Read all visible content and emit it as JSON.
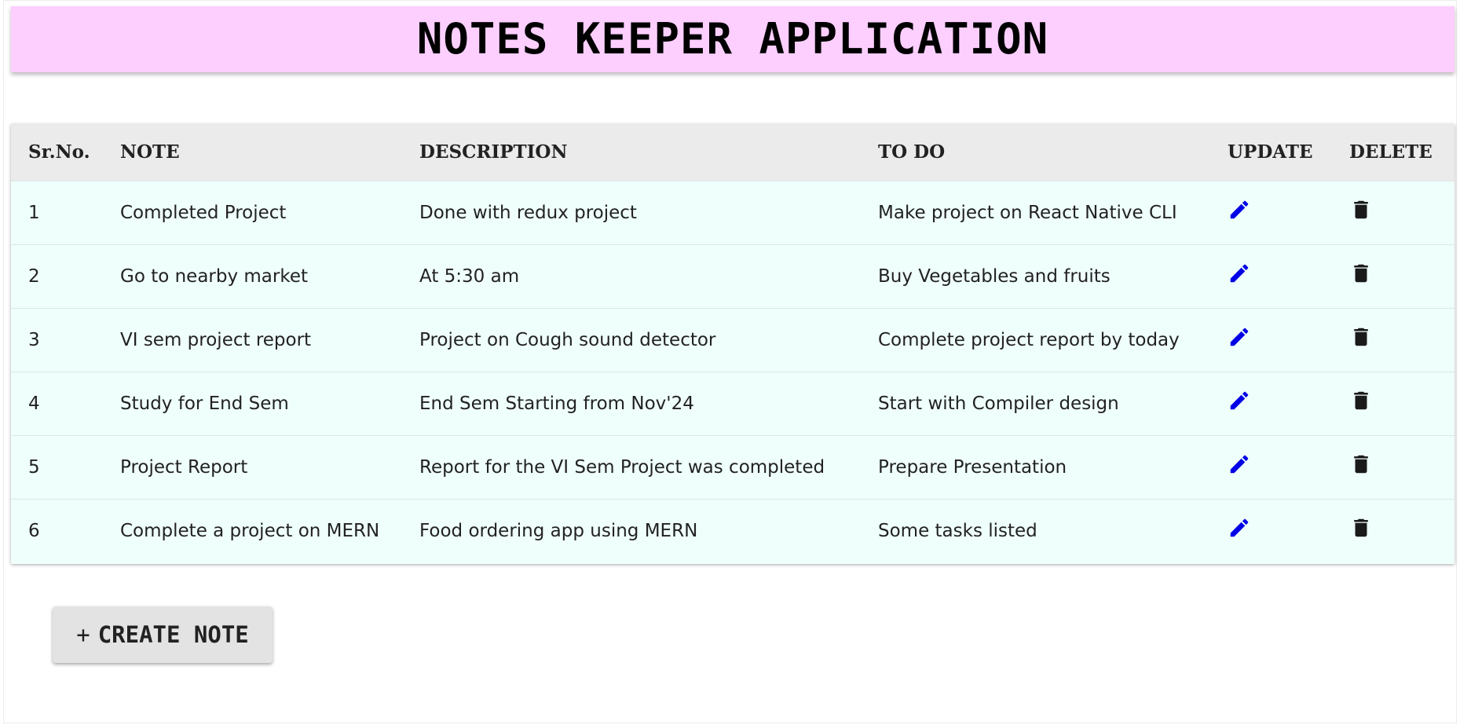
{
  "header": {
    "title": "NOTES KEEPER APPLICATION"
  },
  "table": {
    "columns": [
      "Sr.No.",
      "NOTE",
      "DESCRIPTION",
      "TO DO",
      "UPDATE",
      "DELETE"
    ],
    "rows": [
      {
        "sr": "1",
        "note": "Completed Project",
        "description": "Done with redux project",
        "todo": "Make project on React Native CLI"
      },
      {
        "sr": "2",
        "note": "Go to nearby market",
        "description": "At 5:30 am",
        "todo": "Buy Vegetables and fruits"
      },
      {
        "sr": "3",
        "note": "VI sem project report",
        "description": "Project on Cough sound detector",
        "todo": "Complete project report by today"
      },
      {
        "sr": "4",
        "note": "Study for End Sem",
        "description": "End Sem Starting from Nov'24",
        "todo": "Start with Compiler design"
      },
      {
        "sr": "5",
        "note": "Project Report",
        "description": "Report for the VI Sem Project was completed",
        "todo": "Prepare Presentation"
      },
      {
        "sr": "6",
        "note": "Complete a project on MERN",
        "description": "Food ordering app using MERN",
        "todo": "Some tasks listed"
      }
    ],
    "update_icon": "pencil-icon",
    "delete_icon": "trash-icon"
  },
  "actions": {
    "create_plus": "+",
    "create_label": "CREATE NOTE"
  },
  "colors": {
    "header_bg": "#fccfff",
    "table_header_bg": "#ebebeb",
    "row_bg": "#effffc",
    "edit_icon": "#0000e6",
    "delete_icon": "#1a1a1a",
    "button_bg": "#e3e3e3"
  }
}
